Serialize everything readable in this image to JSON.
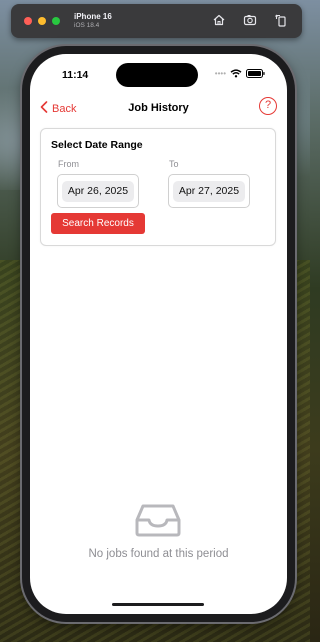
{
  "simulator": {
    "device_name": "iPhone 16",
    "os_version": "iOS 18.4",
    "tools": [
      "home-icon",
      "screenshot-icon",
      "rotate-icon"
    ]
  },
  "status_bar": {
    "time": "11:14",
    "dots": "••••"
  },
  "nav": {
    "back_label": "Back",
    "title": "Job History",
    "help_label": "?"
  },
  "date_range": {
    "heading": "Select Date Range",
    "from_label": "From",
    "to_label": "To",
    "from_value": "Apr 26, 2025",
    "to_value": "Apr 27, 2025",
    "search_label": "Search Records"
  },
  "empty_state": {
    "icon": "inbox-icon",
    "message": "No jobs found at this period"
  },
  "colors": {
    "accent": "#e53935",
    "muted_text": "#8e8e93",
    "date_pill_bg": "#ececee"
  }
}
